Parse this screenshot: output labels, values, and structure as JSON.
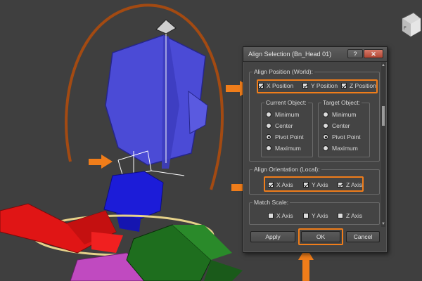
{
  "dialog": {
    "title": "Align Selection (Bn_Head 01)",
    "help_label": "?",
    "close_label": "✕",
    "align_position": {
      "label": "Align Position (World):",
      "x": "X Position",
      "y": "Y Position",
      "z": "Z Position",
      "x_checked": true,
      "y_checked": true,
      "z_checked": true
    },
    "current_object": {
      "label": "Current Object:",
      "options": [
        "Minimum",
        "Center",
        "Pivot Point",
        "Maximum"
      ],
      "selected": "Pivot Point"
    },
    "target_object": {
      "label": "Target Object:",
      "options": [
        "Minimum",
        "Center",
        "Pivot Point",
        "Maximum"
      ],
      "selected": "Pivot Point"
    },
    "align_orientation": {
      "label": "Align Orientation (Local):",
      "x": "X Axis",
      "y": "Y Axis",
      "z": "Z Axis",
      "x_checked": true,
      "y_checked": true,
      "z_checked": true
    },
    "match_scale": {
      "label": "Match Scale:",
      "x": "X Axis",
      "y": "Y Axis",
      "z": "Z Axis",
      "x_checked": false,
      "y_checked": false,
      "z_checked": false
    },
    "buttons": {
      "apply": "Apply",
      "ok": "OK",
      "cancel": "Cancel"
    }
  },
  "colors": {
    "viewport_bg": "#3f3f3f",
    "highlight": "#f07d1a",
    "head": "#4b4bd6",
    "neck": "#1c1cd8",
    "arm_red": "#e01515",
    "arm_green": "#1e6e1e",
    "torso_magenta": "#c04ac0",
    "orbit_ring": "#a34a12",
    "base_ring": "#e6d28a"
  },
  "viewcube_label": "F"
}
